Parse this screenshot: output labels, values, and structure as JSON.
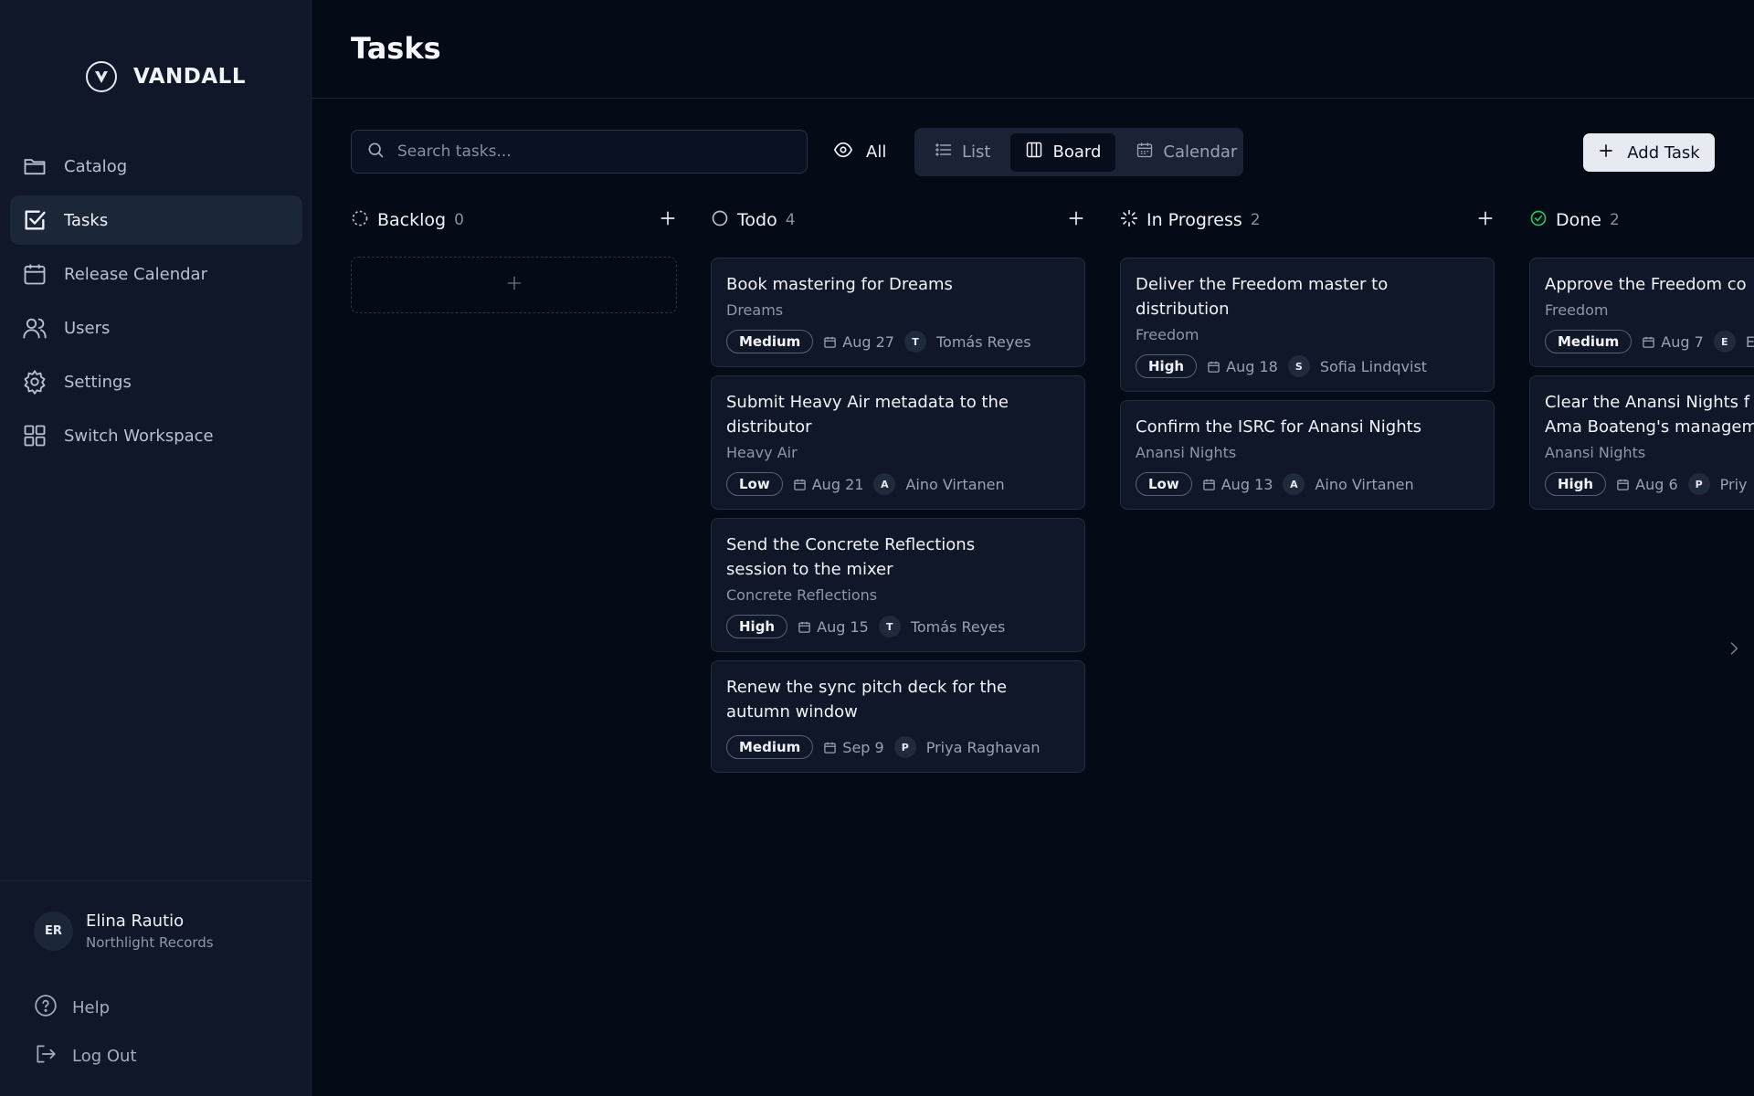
{
  "app": {
    "brand": "VANDALL"
  },
  "sidebar": {
    "items": [
      {
        "label": "Catalog",
        "icon": "folder-icon"
      },
      {
        "label": "Tasks",
        "icon": "check-square-icon",
        "active": true
      },
      {
        "label": "Release Calendar",
        "icon": "calendar-icon"
      },
      {
        "label": "Users",
        "icon": "users-icon"
      },
      {
        "label": "Settings",
        "icon": "gear-icon"
      },
      {
        "label": "Switch Workspace",
        "icon": "grid-icon"
      }
    ],
    "user": {
      "initials": "ER",
      "name": "Elina Rautio",
      "org": "Northlight Records"
    },
    "help_label": "Help",
    "logout_label": "Log Out"
  },
  "header": {
    "title": "Tasks"
  },
  "toolbar": {
    "search_placeholder": "Search tasks...",
    "filter_label": "All",
    "views": [
      {
        "label": "List",
        "icon": "list-icon"
      },
      {
        "label": "Board",
        "icon": "board-icon",
        "active": true
      },
      {
        "label": "Calendar",
        "icon": "calendar-icon"
      }
    ],
    "add_task_label": "Add Task"
  },
  "columns": [
    {
      "title": "Backlog",
      "count": "0",
      "status_icon": "dashed-circle-icon",
      "cards": []
    },
    {
      "title": "Todo",
      "count": "4",
      "status_icon": "circle-icon",
      "cards": [
        {
          "title": "Book mastering for Dreams",
          "project": "Dreams",
          "priority": "Medium",
          "date": "Aug 27",
          "assignee_initial": "T",
          "assignee": "Tomás Reyes"
        },
        {
          "title": "Submit Heavy Air metadata to the distributor",
          "project": "Heavy Air",
          "priority": "Low",
          "date": "Aug 21",
          "assignee_initial": "A",
          "assignee": "Aino Virtanen"
        },
        {
          "title": "Send the Concrete Reflections session to the mixer",
          "project": "Concrete Reflections",
          "priority": "High",
          "date": "Aug 15",
          "assignee_initial": "T",
          "assignee": "Tomás Reyes"
        },
        {
          "title": "Renew the sync pitch deck for the autumn window",
          "project": "",
          "priority": "Medium",
          "date": "Sep 9",
          "assignee_initial": "P",
          "assignee": "Priya Raghavan"
        }
      ]
    },
    {
      "title": "In Progress",
      "count": "2",
      "status_icon": "spinner-icon",
      "cards": [
        {
          "title": "Deliver the Freedom master to distribution",
          "project": "Freedom",
          "priority": "High",
          "date": "Aug 18",
          "assignee_initial": "S",
          "assignee": "Sofia Lindqvist"
        },
        {
          "title": "Confirm the ISRC for Anansi Nights",
          "project": "Anansi Nights",
          "priority": "Low",
          "date": "Aug 13",
          "assignee_initial": "A",
          "assignee": "Aino Virtanen"
        }
      ]
    },
    {
      "title": "Done",
      "count": "2",
      "status_icon": "check-circle-icon",
      "status_color": "#22c55e",
      "cards": [
        {
          "title": "Approve the Freedom co",
          "project": "Freedom",
          "priority": "Medium",
          "date": "Aug 7",
          "assignee_initial": "E",
          "assignee": "E"
        },
        {
          "title": "Clear the Anansi Nights f Ama Boateng's managem",
          "project": "Anansi Nights",
          "priority": "High",
          "date": "Aug 6",
          "assignee_initial": "P",
          "assignee": "Priy"
        }
      ]
    }
  ]
}
